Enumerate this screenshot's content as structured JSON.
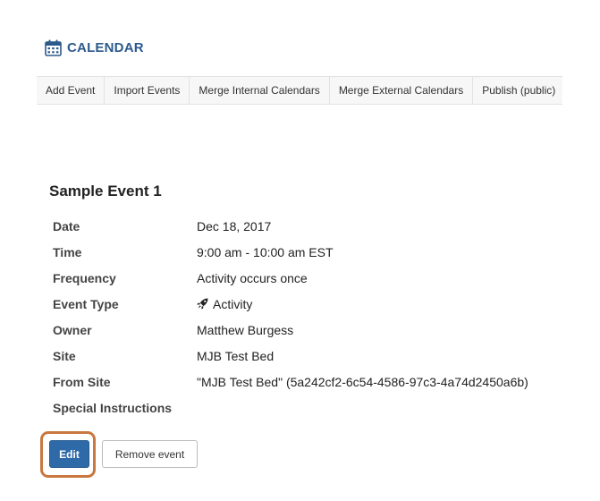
{
  "header": {
    "title": "CALENDAR",
    "icon": "calendar-icon",
    "accent_color": "#2c5a8c"
  },
  "nav": {
    "items": [
      "Add Event",
      "Import Events",
      "Merge Internal Calendars",
      "Merge External Calendars",
      "Publish (public)"
    ]
  },
  "event": {
    "title": "Sample Event 1",
    "details": [
      {
        "label": "Date",
        "value": "Dec 18, 2017"
      },
      {
        "label": "Time",
        "value": "9:00 am - 10:00 am EST"
      },
      {
        "label": "Frequency",
        "value": "Activity occurs once"
      },
      {
        "label": "Event Type",
        "value": "Activity",
        "icon": "rocket-icon"
      },
      {
        "label": "Owner",
        "value": "Matthew Burgess"
      },
      {
        "label": "Site",
        "value": "MJB Test Bed"
      },
      {
        "label": "From Site",
        "value": "\"MJB Test Bed\" (5a242cf2-6c54-4586-97c3-4a74d2450a6b)"
      },
      {
        "label": "Special Instructions",
        "value": ""
      }
    ]
  },
  "actions": {
    "edit_label": "Edit",
    "remove_label": "Remove event",
    "edit_color": "#2f6aa8",
    "highlight_color": "#c87840"
  }
}
